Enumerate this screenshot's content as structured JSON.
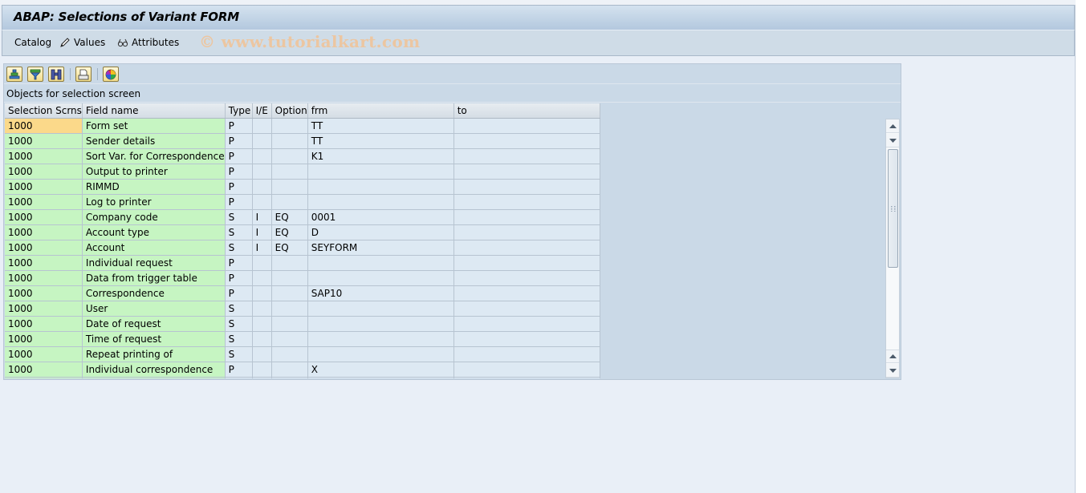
{
  "window": {
    "title": "ABAP: Selections of Variant FORM"
  },
  "toolbar": {
    "catalog_label": "Catalog",
    "values_label": "Values",
    "values_icon": "pencil-icon",
    "attributes_label": "Attributes",
    "attributes_icon": "glasses-icon",
    "watermark": "© www.tutorialkart.com"
  },
  "grid_toolbar": {
    "buttons": [
      {
        "name": "sort-ascending-button",
        "icon": "sort-ascending-icon"
      },
      {
        "name": "filter-button",
        "icon": "filter-icon"
      },
      {
        "name": "find-button",
        "icon": "binoculars-icon"
      },
      {
        "name": "print-button",
        "icon": "printer-icon"
      },
      {
        "name": "layout-button",
        "icon": "color-wheel-icon"
      }
    ]
  },
  "grid": {
    "caption": "Objects for selection screen",
    "columns": [
      "Selection Scrns",
      "Field name",
      "Type",
      "I/E",
      "Option",
      "frm",
      "to"
    ],
    "rows": [
      {
        "screen": "1000",
        "field": "Form set",
        "type": "P",
        "ie": "",
        "option": "",
        "frm": "TT",
        "to": ""
      },
      {
        "screen": "1000",
        "field": "Sender details",
        "type": "P",
        "ie": "",
        "option": "",
        "frm": "TT",
        "to": ""
      },
      {
        "screen": "1000",
        "field": "Sort Var. for Correspondence",
        "type": "P",
        "ie": "",
        "option": "",
        "frm": "K1",
        "to": ""
      },
      {
        "screen": "1000",
        "field": "Output to printer",
        "type": "P",
        "ie": "",
        "option": "",
        "frm": "",
        "to": ""
      },
      {
        "screen": "1000",
        "field": "RIMMD",
        "type": "P",
        "ie": "",
        "option": "",
        "frm": "",
        "to": ""
      },
      {
        "screen": "1000",
        "field": "Log to printer",
        "type": "P",
        "ie": "",
        "option": "",
        "frm": "",
        "to": ""
      },
      {
        "screen": "1000",
        "field": "Company code",
        "type": "S",
        "ie": "I",
        "option": "EQ",
        "frm": "0001",
        "to": ""
      },
      {
        "screen": "1000",
        "field": "Account type",
        "type": "S",
        "ie": "I",
        "option": "EQ",
        "frm": "D",
        "to": ""
      },
      {
        "screen": "1000",
        "field": "Account",
        "type": "S",
        "ie": "I",
        "option": "EQ",
        "frm": "SEYFORM",
        "to": ""
      },
      {
        "screen": "1000",
        "field": "Individual request",
        "type": "P",
        "ie": "",
        "option": "",
        "frm": "",
        "to": ""
      },
      {
        "screen": "1000",
        "field": "Data from trigger table",
        "type": "P",
        "ie": "",
        "option": "",
        "frm": "",
        "to": ""
      },
      {
        "screen": "1000",
        "field": "Correspondence",
        "type": "P",
        "ie": "",
        "option": "",
        "frm": "SAP10",
        "to": ""
      },
      {
        "screen": "1000",
        "field": "User",
        "type": "S",
        "ie": "",
        "option": "",
        "frm": "",
        "to": ""
      },
      {
        "screen": "1000",
        "field": "Date of request",
        "type": "S",
        "ie": "",
        "option": "",
        "frm": "",
        "to": ""
      },
      {
        "screen": "1000",
        "field": "Time of request",
        "type": "S",
        "ie": "",
        "option": "",
        "frm": "",
        "to": ""
      },
      {
        "screen": "1000",
        "field": "Repeat printing of",
        "type": "S",
        "ie": "",
        "option": "",
        "frm": "",
        "to": ""
      },
      {
        "screen": "1000",
        "field": "Individual correspondence",
        "type": "P",
        "ie": "",
        "option": "",
        "frm": "X",
        "to": ""
      }
    ]
  },
  "colors": {
    "key_cell": "#c6f5c2",
    "selected_cell": "#fbd98a",
    "data_cell": "#dde9f3",
    "title_gradient_top": "#d4e2ef",
    "title_gradient_bottom": "#b3c8de"
  }
}
